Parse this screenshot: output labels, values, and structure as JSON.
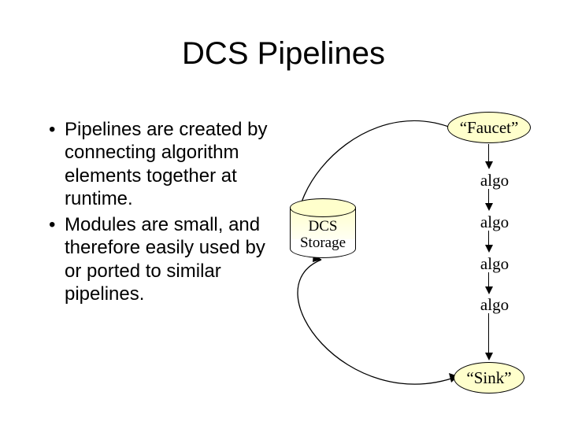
{
  "title": "DCS Pipelines",
  "bullets": [
    "Pipelines are created by connecting algorithm elements together at runtime.",
    "Modules are small, and therefore easily used by or ported to similar pipelines."
  ],
  "diagram": {
    "faucet_label": "“Faucet”",
    "sink_label": "“Sink”",
    "algo_labels": [
      "algo",
      "algo",
      "algo",
      "algo"
    ],
    "storage_label_line1": "DCS",
    "storage_label_line2": "Storage"
  }
}
